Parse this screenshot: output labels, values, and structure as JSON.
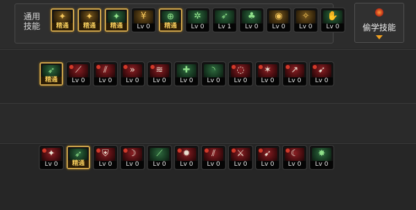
{
  "common_skills": {
    "label": "通用\n技能",
    "slots": [
      {
        "icon": "sprinting-figure-icon",
        "glyph": "✦",
        "style": "gold",
        "level": "精通",
        "mastered": true
      },
      {
        "icon": "leaping-figure-icon",
        "glyph": "✦",
        "style": "gold",
        "level": "精通",
        "mastered": true
      },
      {
        "icon": "kick-figure-icon",
        "glyph": "✦",
        "style": "green",
        "level": "精通",
        "mastered": true
      },
      {
        "icon": "winged-emblem-icon",
        "glyph": "¥",
        "style": "gold",
        "level": "Lv 0",
        "mastered": false
      },
      {
        "icon": "crosshair-icon",
        "glyph": "⊕",
        "style": "green",
        "level": "精通",
        "mastered": true
      },
      {
        "icon": "gear-burst-icon",
        "glyph": "✲",
        "style": "green",
        "level": "Lv 0",
        "mastered": false
      },
      {
        "icon": "running-warrior-icon",
        "glyph": "➶",
        "style": "green",
        "level": "Lv 1",
        "mastered": false
      },
      {
        "icon": "meditating-figure-icon",
        "glyph": "♣",
        "style": "green",
        "level": "Lv 0",
        "mastered": false
      },
      {
        "icon": "golden-eye-icon",
        "glyph": "◉",
        "style": "gold",
        "level": "Lv 0",
        "mastered": false
      },
      {
        "icon": "power-stance-icon",
        "glyph": "✧",
        "style": "gold",
        "level": "Lv 0",
        "mastered": false
      },
      {
        "icon": "fist-strike-icon",
        "glyph": "✋",
        "style": "green",
        "level": "Lv 0",
        "mastered": false
      }
    ]
  },
  "steal_button": {
    "label": "偷学技能"
  },
  "row_two": [
    {
      "icon": "green-dash-icon",
      "glyph": "➶",
      "style": "green",
      "level": "精通",
      "mastered": true
    },
    {
      "icon": "blade-slash-icon",
      "glyph": "⟋",
      "style": "red",
      "level": "Lv 0",
      "mastered": false
    },
    {
      "icon": "double-slash-icon",
      "glyph": "⫽",
      "style": "red",
      "level": "Lv 0",
      "mastered": false
    },
    {
      "icon": "arrow-chevrons-icon",
      "glyph": "»",
      "style": "red",
      "level": "Lv 0",
      "mastered": false
    },
    {
      "icon": "whirlwind-icon",
      "glyph": "≋",
      "style": "red",
      "level": "Lv 0",
      "mastered": false
    },
    {
      "icon": "shield-cross-icon",
      "glyph": "✚",
      "style": "green",
      "level": "Lv 0",
      "mastered": false
    },
    {
      "icon": "green-arc-icon",
      "glyph": "◝",
      "style": "green",
      "level": "Lv 0",
      "mastered": false
    },
    {
      "icon": "red-spiral-icon",
      "glyph": "◌",
      "style": "red",
      "level": "Lv 0",
      "mastered": false
    },
    {
      "icon": "flame-swipe-icon",
      "glyph": "✶",
      "style": "red",
      "level": "Lv 0",
      "mastered": false
    },
    {
      "icon": "rising-slash-icon",
      "glyph": "↗",
      "style": "red",
      "level": "Lv 0",
      "mastered": false
    },
    {
      "icon": "wing-strike-icon",
      "glyph": "➹",
      "style": "red",
      "level": "Lv 0",
      "mastered": false
    }
  ],
  "row_three": [
    {
      "icon": "golden-claw-icon",
      "glyph": "✦",
      "style": "red",
      "level": "Lv 0",
      "mastered": false
    },
    {
      "icon": "green-spear-icon",
      "glyph": "➶",
      "style": "green",
      "level": "精通",
      "mastered": true
    },
    {
      "icon": "sword-shield-icon",
      "glyph": "⛨",
      "style": "red",
      "level": "Lv 0",
      "mastered": false
    },
    {
      "icon": "curved-blade-icon",
      "glyph": "☽",
      "style": "red",
      "level": "Lv 0",
      "mastered": false
    },
    {
      "icon": "green-slash-icon",
      "glyph": "⟋",
      "style": "green",
      "level": "Lv 0",
      "mastered": false
    },
    {
      "icon": "flame-burst-icon",
      "glyph": "✹",
      "style": "red",
      "level": "Lv 0",
      "mastered": false
    },
    {
      "icon": "twin-blade-icon",
      "glyph": "⫽",
      "style": "red",
      "level": "Lv 0",
      "mastered": false
    },
    {
      "icon": "dagger-fan-icon",
      "glyph": "⚔",
      "style": "red",
      "level": "Lv 0",
      "mastered": false
    },
    {
      "icon": "golden-wing-icon",
      "glyph": "➹",
      "style": "red",
      "level": "Lv 0",
      "mastered": false
    },
    {
      "icon": "crescent-icon",
      "glyph": "☾",
      "style": "red",
      "level": "Lv 0",
      "mastered": false
    },
    {
      "icon": "star-burst-icon",
      "glyph": "✸",
      "style": "green",
      "level": "Lv 0",
      "mastered": false
    }
  ]
}
